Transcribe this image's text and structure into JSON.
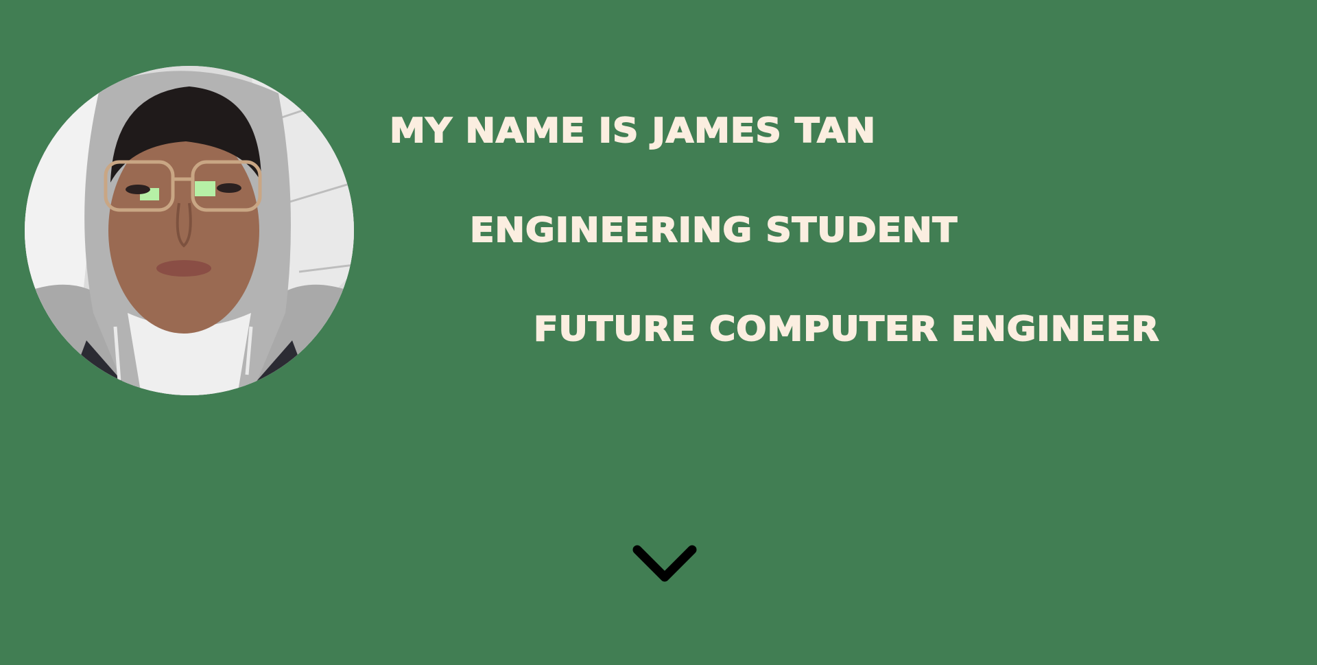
{
  "profile": {
    "photo_icon": "profile-photo"
  },
  "hero": {
    "name_line": "MY NAME IS JAMES TAN",
    "role_line": "ENGINEERING STUDENT",
    "goal_line": "FUTURE COMPUTER ENGINEER"
  },
  "scroll": {
    "icon": "chevron-down-icon"
  },
  "colors": {
    "background": "#417e53",
    "text": "#fbeee0",
    "chevron": "#000000"
  }
}
